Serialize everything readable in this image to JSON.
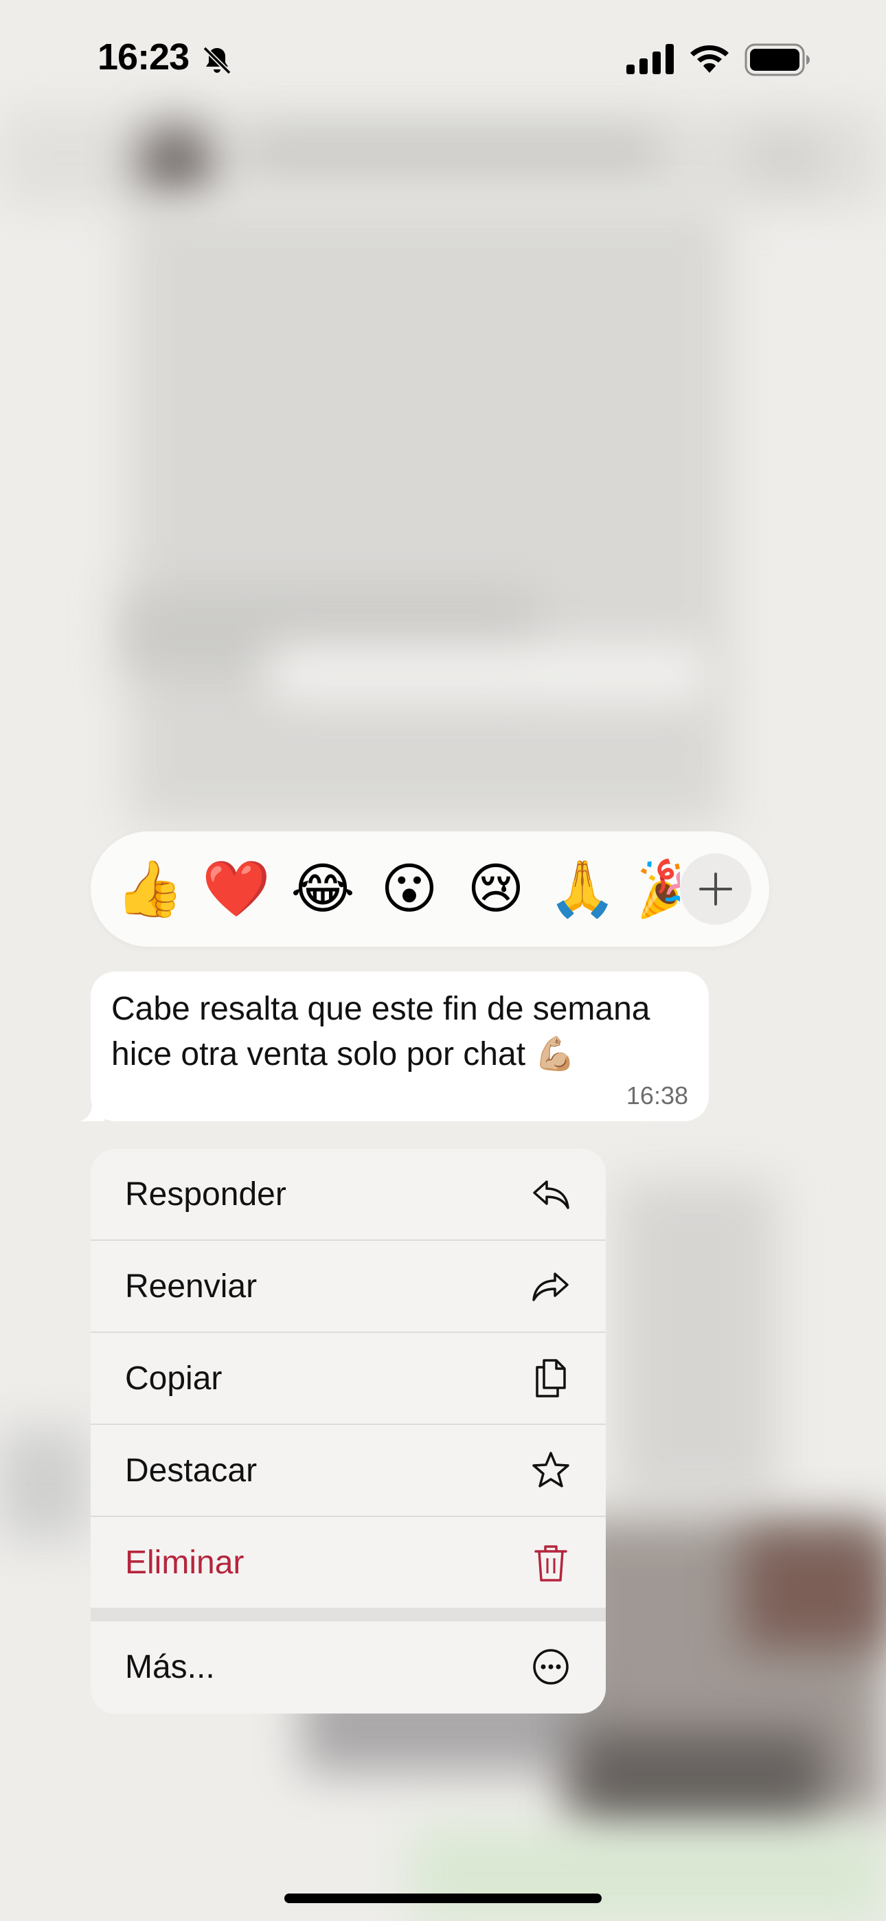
{
  "status_bar": {
    "time": "16:23",
    "icons": [
      "bell-slash-icon",
      "signal-icon",
      "wifi-icon",
      "battery-icon"
    ]
  },
  "reactions": {
    "items": [
      {
        "name": "thumbs-up",
        "glyph": "👍"
      },
      {
        "name": "red-heart",
        "glyph": "❤️"
      },
      {
        "name": "tears-of-joy",
        "glyph": "😂"
      },
      {
        "name": "surprised",
        "glyph": "😮"
      },
      {
        "name": "crying",
        "glyph": "😢"
      },
      {
        "name": "folded-hands",
        "glyph": "🙏"
      },
      {
        "name": "party-popper",
        "glyph": "🎉"
      }
    ],
    "more_icon": "plus-icon"
  },
  "message": {
    "text": "Cabe resalta que este fin de semana hice otra venta solo por chat 💪🏼",
    "time": "16:38"
  },
  "menu": {
    "items": [
      {
        "label": "Responder",
        "icon": "reply-icon"
      },
      {
        "label": "Reenviar",
        "icon": "forward-icon"
      },
      {
        "label": "Copiar",
        "icon": "copy-icon"
      },
      {
        "label": "Destacar",
        "icon": "star-icon"
      },
      {
        "label": "Eliminar",
        "icon": "trash-icon",
        "destructive": true
      },
      {
        "label": "Más...",
        "icon": "more-circle-icon"
      }
    ]
  },
  "colors": {
    "background": "#eeedea",
    "menu_background": "#f4f3f2",
    "destructive": "#b5253c",
    "bubble": "#ffffff"
  }
}
